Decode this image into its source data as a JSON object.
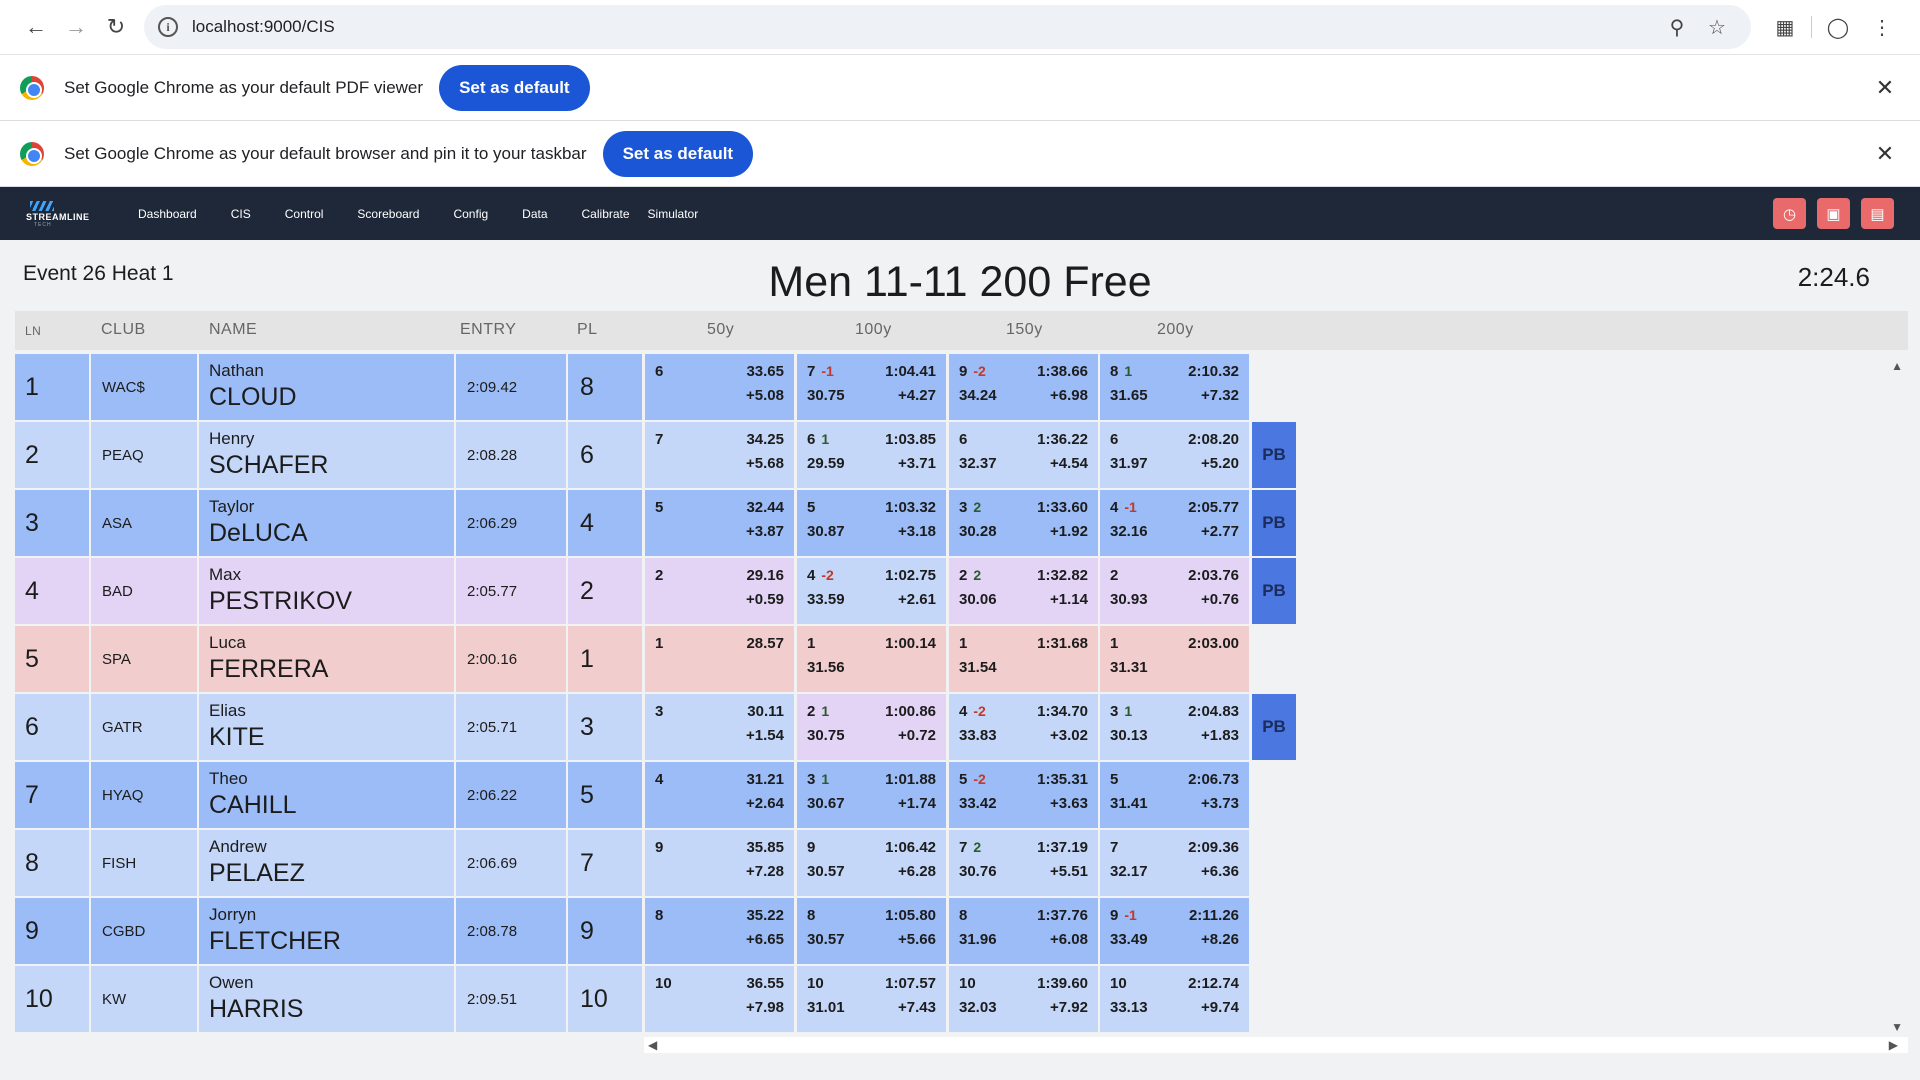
{
  "browser": {
    "url": "localhost:9000/CIS"
  },
  "infobars": [
    {
      "text": "Set Google Chrome as your default PDF viewer",
      "button": "Set as default"
    },
    {
      "text": "Set Google Chrome as your default browser and pin it to your taskbar",
      "button": "Set as default"
    }
  ],
  "app": {
    "logo_text": "STREAMLINE",
    "logo_sub": "TECH",
    "nav": [
      "Dashboard",
      "CIS",
      "Control",
      "Scoreboard",
      "Config",
      "Data",
      "Calibrate",
      "Simulator"
    ],
    "actions": [
      "clock-icon",
      "video-camera-icon",
      "table-icon"
    ]
  },
  "event": {
    "label": "Event 26 Heat 1",
    "title": "Men 11-11 200 Free",
    "clock": "2:24.6"
  },
  "columns": {
    "ln": "LN",
    "club": "CLUB",
    "name": "NAME",
    "entry": "ENTRY",
    "pl": "PL",
    "splits": [
      "50y",
      "100y",
      "150y",
      "200y"
    ]
  },
  "colors": {
    "blue_dark": "#9bbcf6",
    "blue_light": "#c4d7f8",
    "purple": "#e3d4f6",
    "red": "#f2cdcd",
    "pb": "#4a77e0",
    "nav_bg": "#1f2838",
    "nav_action": "#e86a6a"
  },
  "lanes": [
    {
      "ln": "1",
      "club": "WAC$",
      "first": "Nathan",
      "last": "CLOUD",
      "entry": "2:09.42",
      "pl": "8",
      "color": "blue_dark",
      "pb": "",
      "splits": [
        {
          "place": "6",
          "delta": "",
          "cum": "33.65",
          "lap": "",
          "diff": "+5.08",
          "color": "blue_dark"
        },
        {
          "place": "7",
          "delta": "-1",
          "cum": "1:04.41",
          "lap": "30.75",
          "diff": "+4.27",
          "color": "blue_dark"
        },
        {
          "place": "9",
          "delta": "-2",
          "cum": "1:38.66",
          "lap": "34.24",
          "diff": "+6.98",
          "color": "blue_dark"
        },
        {
          "place": "8",
          "delta": "1",
          "cum": "2:10.32",
          "lap": "31.65",
          "diff": "+7.32",
          "color": "blue_dark"
        }
      ]
    },
    {
      "ln": "2",
      "club": "PEAQ",
      "first": "Henry",
      "last": "SCHAFER",
      "entry": "2:08.28",
      "pl": "6",
      "color": "blue_light",
      "pb": "PB",
      "splits": [
        {
          "place": "7",
          "delta": "",
          "cum": "34.25",
          "lap": "",
          "diff": "+5.68",
          "color": "blue_light"
        },
        {
          "place": "6",
          "delta": "1",
          "cum": "1:03.85",
          "lap": "29.59",
          "diff": "+3.71",
          "color": "blue_light"
        },
        {
          "place": "6",
          "delta": "",
          "cum": "1:36.22",
          "lap": "32.37",
          "diff": "+4.54",
          "color": "blue_light"
        },
        {
          "place": "6",
          "delta": "",
          "cum": "2:08.20",
          "lap": "31.97",
          "diff": "+5.20",
          "color": "blue_light"
        }
      ]
    },
    {
      "ln": "3",
      "club": "ASA",
      "first": "Taylor",
      "last": "DeLUCA",
      "entry": "2:06.29",
      "pl": "4",
      "color": "blue_dark",
      "pb": "PB",
      "splits": [
        {
          "place": "5",
          "delta": "",
          "cum": "32.44",
          "lap": "",
          "diff": "+3.87",
          "color": "blue_dark"
        },
        {
          "place": "5",
          "delta": "",
          "cum": "1:03.32",
          "lap": "30.87",
          "diff": "+3.18",
          "color": "blue_dark"
        },
        {
          "place": "3",
          "delta": "2",
          "cum": "1:33.60",
          "lap": "30.28",
          "diff": "+1.92",
          "color": "blue_dark"
        },
        {
          "place": "4",
          "delta": "-1",
          "cum": "2:05.77",
          "lap": "32.16",
          "diff": "+2.77",
          "color": "blue_dark"
        }
      ]
    },
    {
      "ln": "4",
      "club": "BAD",
      "first": "Max",
      "last": "PESTRIKOV",
      "entry": "2:05.77",
      "pl": "2",
      "color": "purple",
      "pb": "PB",
      "splits": [
        {
          "place": "2",
          "delta": "",
          "cum": "29.16",
          "lap": "",
          "diff": "+0.59",
          "color": "purple"
        },
        {
          "place": "4",
          "delta": "-2",
          "cum": "1:02.75",
          "lap": "33.59",
          "diff": "+2.61",
          "color": "blue_light"
        },
        {
          "place": "2",
          "delta": "2",
          "cum": "1:32.82",
          "lap": "30.06",
          "diff": "+1.14",
          "color": "purple"
        },
        {
          "place": "2",
          "delta": "",
          "cum": "2:03.76",
          "lap": "30.93",
          "diff": "+0.76",
          "color": "purple"
        }
      ]
    },
    {
      "ln": "5",
      "club": "SPA",
      "first": "Luca",
      "last": "FERRERA",
      "entry": "2:00.16",
      "pl": "1",
      "color": "red",
      "pb": "",
      "splits": [
        {
          "place": "1",
          "delta": "",
          "cum": "28.57",
          "lap": "",
          "diff": "",
          "color": "red"
        },
        {
          "place": "1",
          "delta": "",
          "cum": "1:00.14",
          "lap": "31.56",
          "diff": "",
          "color": "red"
        },
        {
          "place": "1",
          "delta": "",
          "cum": "1:31.68",
          "lap": "31.54",
          "diff": "",
          "color": "red"
        },
        {
          "place": "1",
          "delta": "",
          "cum": "2:03.00",
          "lap": "31.31",
          "diff": "",
          "color": "red"
        }
      ]
    },
    {
      "ln": "6",
      "club": "GATR",
      "first": "Elias",
      "last": "KITE",
      "entry": "2:05.71",
      "pl": "3",
      "color": "blue_light",
      "pb": "PB",
      "splits": [
        {
          "place": "3",
          "delta": "",
          "cum": "30.11",
          "lap": "",
          "diff": "+1.54",
          "color": "blue_light"
        },
        {
          "place": "2",
          "delta": "1",
          "cum": "1:00.86",
          "lap": "30.75",
          "diff": "+0.72",
          "color": "purple"
        },
        {
          "place": "4",
          "delta": "-2",
          "cum": "1:34.70",
          "lap": "33.83",
          "diff": "+3.02",
          "color": "blue_light"
        },
        {
          "place": "3",
          "delta": "1",
          "cum": "2:04.83",
          "lap": "30.13",
          "diff": "+1.83",
          "color": "blue_light"
        }
      ]
    },
    {
      "ln": "7",
      "club": "HYAQ",
      "first": "Theo",
      "last": "CAHILL",
      "entry": "2:06.22",
      "pl": "5",
      "color": "blue_dark",
      "pb": "",
      "splits": [
        {
          "place": "4",
          "delta": "",
          "cum": "31.21",
          "lap": "",
          "diff": "+2.64",
          "color": "blue_dark"
        },
        {
          "place": "3",
          "delta": "1",
          "cum": "1:01.88",
          "lap": "30.67",
          "diff": "+1.74",
          "color": "blue_dark"
        },
        {
          "place": "5",
          "delta": "-2",
          "cum": "1:35.31",
          "lap": "33.42",
          "diff": "+3.63",
          "color": "blue_dark"
        },
        {
          "place": "5",
          "delta": "",
          "cum": "2:06.73",
          "lap": "31.41",
          "diff": "+3.73",
          "color": "blue_dark"
        }
      ]
    },
    {
      "ln": "8",
      "club": "FISH",
      "first": "Andrew",
      "last": "PELAEZ",
      "entry": "2:06.69",
      "pl": "7",
      "color": "blue_light",
      "pb": "",
      "splits": [
        {
          "place": "9",
          "delta": "",
          "cum": "35.85",
          "lap": "",
          "diff": "+7.28",
          "color": "blue_light"
        },
        {
          "place": "9",
          "delta": "",
          "cum": "1:06.42",
          "lap": "30.57",
          "diff": "+6.28",
          "color": "blue_light"
        },
        {
          "place": "7",
          "delta": "2",
          "cum": "1:37.19",
          "lap": "30.76",
          "diff": "+5.51",
          "color": "blue_light"
        },
        {
          "place": "7",
          "delta": "",
          "cum": "2:09.36",
          "lap": "32.17",
          "diff": "+6.36",
          "color": "blue_light"
        }
      ]
    },
    {
      "ln": "9",
      "club": "CGBD",
      "first": "Jorryn",
      "last": "FLETCHER",
      "entry": "2:08.78",
      "pl": "9",
      "color": "blue_dark",
      "pb": "",
      "splits": [
        {
          "place": "8",
          "delta": "",
          "cum": "35.22",
          "lap": "",
          "diff": "+6.65",
          "color": "blue_dark"
        },
        {
          "place": "8",
          "delta": "",
          "cum": "1:05.80",
          "lap": "30.57",
          "diff": "+5.66",
          "color": "blue_dark"
        },
        {
          "place": "8",
          "delta": "",
          "cum": "1:37.76",
          "lap": "31.96",
          "diff": "+6.08",
          "color": "blue_dark"
        },
        {
          "place": "9",
          "delta": "-1",
          "cum": "2:11.26",
          "lap": "33.49",
          "diff": "+8.26",
          "color": "blue_dark"
        }
      ]
    },
    {
      "ln": "10",
      "club": "KW",
      "first": "Owen",
      "last": "HARRIS",
      "entry": "2:09.51",
      "pl": "10",
      "color": "blue_light",
      "pb": "",
      "splits": [
        {
          "place": "10",
          "delta": "",
          "cum": "36.55",
          "lap": "",
          "diff": "+7.98",
          "color": "blue_light"
        },
        {
          "place": "10",
          "delta": "",
          "cum": "1:07.57",
          "lap": "31.01",
          "diff": "+7.43",
          "color": "blue_light"
        },
        {
          "place": "10",
          "delta": "",
          "cum": "1:39.60",
          "lap": "32.03",
          "diff": "+7.92",
          "color": "blue_light"
        },
        {
          "place": "10",
          "delta": "",
          "cum": "2:12.74",
          "lap": "33.13",
          "diff": "+9.74",
          "color": "blue_light"
        }
      ]
    }
  ]
}
